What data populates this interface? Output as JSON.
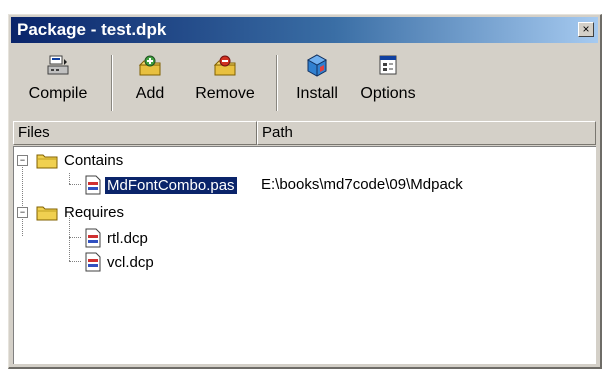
{
  "window": {
    "title": "Package - test.dpk",
    "close_symbol": "×"
  },
  "toolbar": {
    "buttons": [
      {
        "label": "Compile",
        "icon": "compile-icon"
      },
      {
        "label": "Add",
        "icon": "add-icon"
      },
      {
        "label": "Remove",
        "icon": "remove-icon"
      },
      {
        "label": "Install",
        "icon": "install-icon"
      },
      {
        "label": "Options",
        "icon": "options-icon"
      }
    ]
  },
  "columns": {
    "files": "Files",
    "path": "Path"
  },
  "tree": {
    "contains": {
      "label": "Contains",
      "expander": "−",
      "items": [
        {
          "name": "MdFontCombo.pas",
          "path": "E:\\books\\md7code\\09\\Mdpack",
          "selected": true
        }
      ]
    },
    "requires": {
      "label": "Requires",
      "expander": "−",
      "items": [
        {
          "name": "rtl.dcp",
          "path": ""
        },
        {
          "name": "vcl.dcp",
          "path": ""
        }
      ]
    }
  },
  "colors": {
    "title_gradient_start": "#0a246a",
    "title_gradient_end": "#a6caf0",
    "selection": "#0a246a",
    "face": "#d4d0c8"
  }
}
